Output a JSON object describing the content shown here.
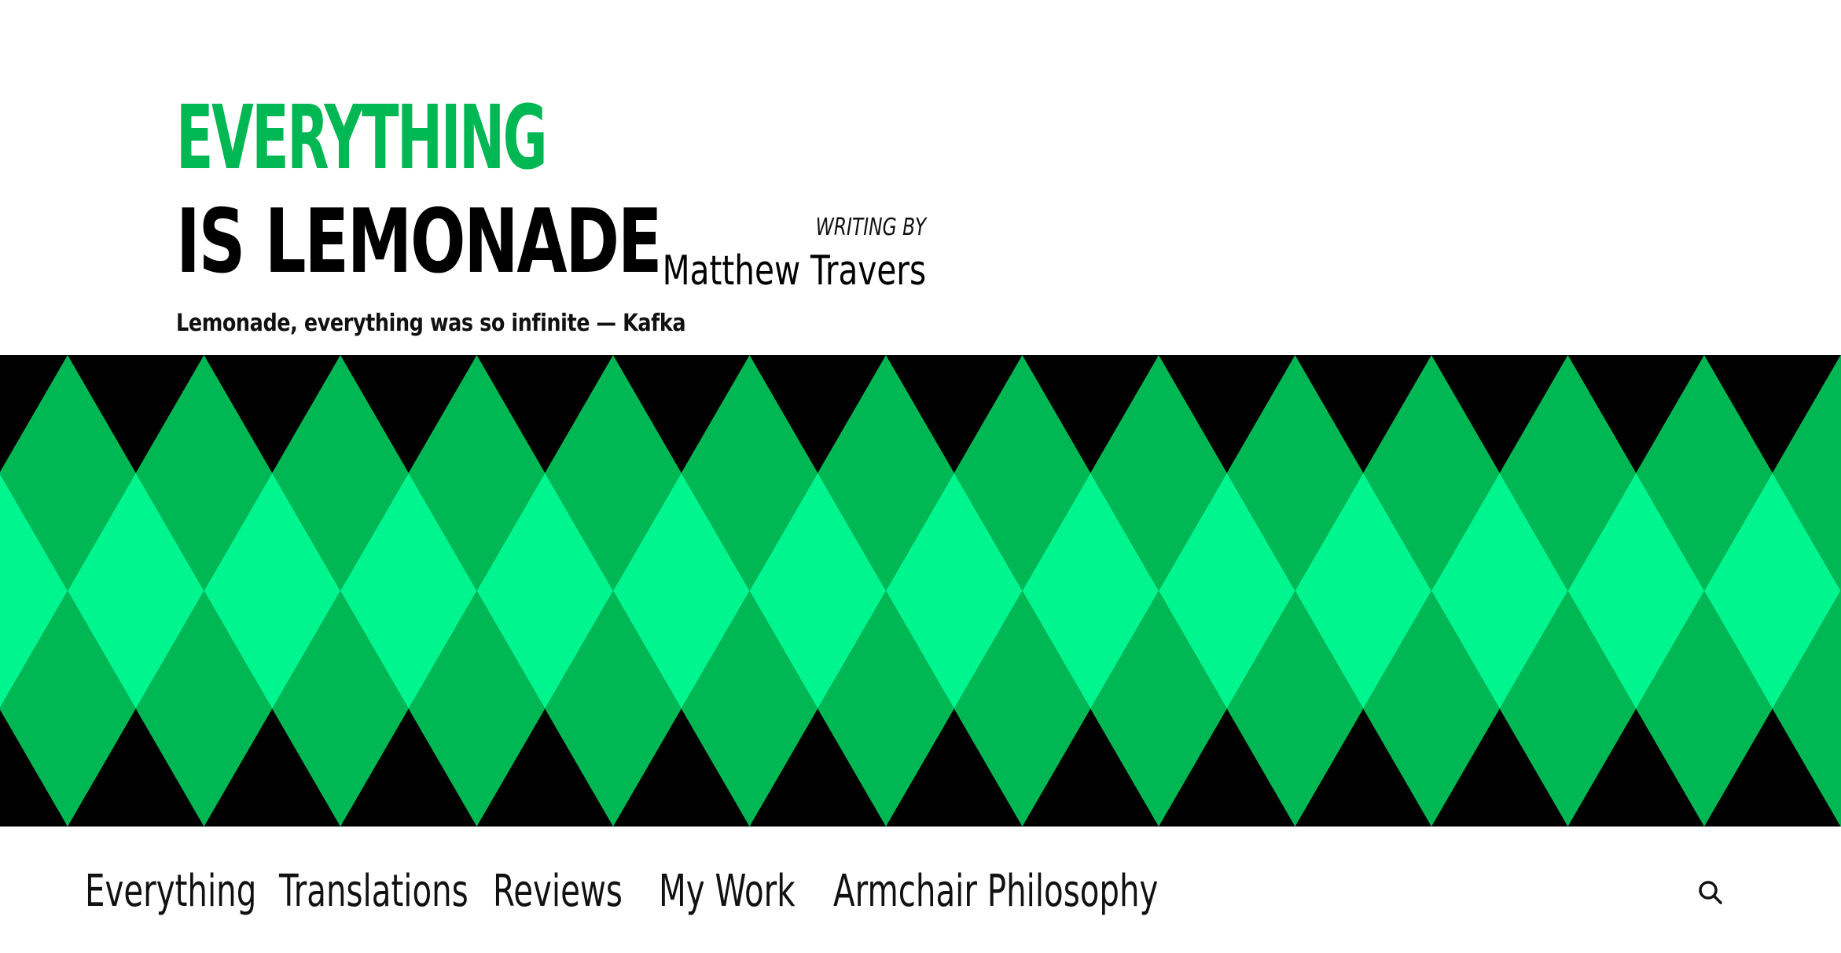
{
  "header": {
    "title_line_1": "Everything",
    "title_line_2": "is Lemonade",
    "tagline": "Lemonade, everything was so infinite — Kafka",
    "byline_label": "Writing by",
    "author": "Matthew Travers"
  },
  "pattern": {
    "colors": {
      "background": "#000000",
      "diamond_dark": "#00b853",
      "diamond_light": "#00f58f"
    }
  },
  "nav": {
    "items": [
      {
        "label": "Everything"
      },
      {
        "label": "Translations"
      },
      {
        "label": "Reviews"
      },
      {
        "label": "My Work"
      },
      {
        "label": "Armchair Philosophy"
      }
    ],
    "search_icon": "search-icon"
  },
  "colors": {
    "accent": "#00b853",
    "text": "#111111",
    "background": "#ffffff"
  }
}
